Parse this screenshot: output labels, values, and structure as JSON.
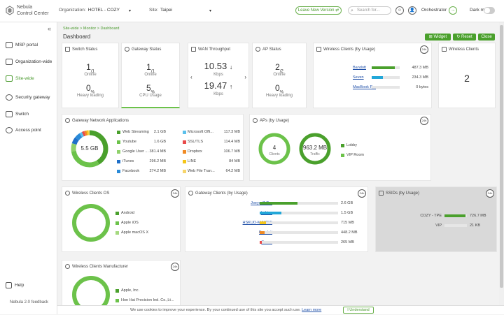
{
  "brand": {
    "line1": "Nebula",
    "line2": "Control Center"
  },
  "header": {
    "org_label": "Organization:",
    "org_value": "HOTEL - COZY",
    "site_label": "Site:",
    "site_value": "Taipei",
    "leave_btn": "Leave New Version",
    "search_placeholder": "Search for...",
    "orchestrator": "Orchestrator",
    "dark_mode": "Dark mode"
  },
  "sidebar": {
    "items": [
      {
        "label": "MSP portal"
      },
      {
        "label": "Organization-wide"
      },
      {
        "label": "Site-wide"
      },
      {
        "label": "Security gateway"
      },
      {
        "label": "Switch"
      },
      {
        "label": "Access point"
      }
    ],
    "help": "Help",
    "feedback": "Nebula 2.0 feedback"
  },
  "breadcrumb": "Site-wide > Monitor > Dashboard",
  "page_title": "Dashboard",
  "actions": {
    "widget": "Widget",
    "reset": "Reset",
    "close": "Close"
  },
  "switch_status": {
    "title": "Switch Status",
    "online": "1",
    "online_total": "/1",
    "online_label": "Online",
    "heavy": "0",
    "heavy_unit": "%",
    "heavy_label": "Heavy loading"
  },
  "gateway_status": {
    "title": "Gateway Status",
    "online": "1",
    "online_total": "/1",
    "online_label": "Online",
    "cpu": "5",
    "cpu_unit": "%",
    "cpu_label": "CPU Usage"
  },
  "wan": {
    "title": "WAN Throughput",
    "down": "10.53",
    "down_unit": "Kbps",
    "up": "19.47",
    "up_unit": "Kbps"
  },
  "ap_status": {
    "title": "AP Status",
    "online": "2",
    "online_total": "/2",
    "online_label": "Online",
    "heavy": "0",
    "heavy_unit": "%",
    "heavy_label": "Heavy loading"
  },
  "wireless_usage": {
    "title": "Wireless Clients (by Usage)",
    "badge": "24h",
    "rows": [
      {
        "name": "Bandott",
        "value": "487.3 MB",
        "pct": 0.82,
        "color": "#4aa02c"
      },
      {
        "name": "Seven",
        "value": "234.3 MB",
        "pct": 0.4,
        "color": "#22a7d8"
      },
      {
        "name": "MacBook Pro",
        "value": "0 bytes",
        "pct": 0,
        "color": "#4aa02c"
      }
    ]
  },
  "wireless_clients": {
    "title": "Wireless Clients",
    "value": "2"
  },
  "gw_apps": {
    "title": "Gateway Network Applications",
    "badge": "24h",
    "center": "5.5 GB",
    "left": [
      {
        "name": "Web Streaming",
        "value": "2.1 GB",
        "color": "#4aa02c"
      },
      {
        "name": "Youtube",
        "value": "1.6 GB",
        "color": "#6cc24a"
      },
      {
        "name": "Google User ...",
        "value": "381.4 MB",
        "color": "#8fd16a"
      },
      {
        "name": "iTunes",
        "value": "296.2 MB",
        "color": "#1e6fc8"
      },
      {
        "name": "Facebook",
        "value": "274.2 MB",
        "color": "#2a8ad8"
      }
    ],
    "right": [
      {
        "name": "Microsoft Offi...",
        "value": "117.3 MB",
        "color": "#5bc0eb"
      },
      {
        "name": "SSL/TLS",
        "value": "114.4 MB",
        "color": "#e84a4a"
      },
      {
        "name": "Dropbox",
        "value": "106.7 MB",
        "color": "#f08a24"
      },
      {
        "name": "LINE",
        "value": "84 MB",
        "color": "#f5c518"
      },
      {
        "name": "Web File Tran...",
        "value": "64.2 MB",
        "color": "#f7d56b"
      }
    ]
  },
  "aps_usage": {
    "title": "APs (by Usage)",
    "badge": "24h",
    "clients_value": "4",
    "clients_label": "Clients",
    "traffic_value": "963.2 MB",
    "traffic_label": "Traffic",
    "legend": [
      {
        "name": "Lobby",
        "color": "#4aa02c"
      },
      {
        "name": "VIP Room",
        "color": "#6cc24a"
      }
    ]
  },
  "wc_os": {
    "title": "Wireless Clients OS",
    "badge": "24h",
    "legend": [
      {
        "name": "Android",
        "color": "#4aa02c"
      },
      {
        "name": "Apple iOS",
        "color": "#6cc24a"
      },
      {
        "name": "Apple macOS X",
        "color": "#a5d97f"
      }
    ]
  },
  "gw_clients": {
    "title": "Gateway Clients (by Usage)",
    "badge": "24h",
    "rows": [
      {
        "name": "Joeys-i7-Pro",
        "value": "2.6 GB",
        "pct": 0.48,
        "color": "#4aa02c"
      },
      {
        "name": "kebing",
        "value": "1.5 GB",
        "pct": 0.28,
        "color": "#22a7d8"
      },
      {
        "name": "HSKUO-M-NZDF",
        "value": "715 MB",
        "pct": 0.08,
        "color": "#f5c518"
      },
      {
        "name": "Bandott",
        "value": "448.2 MB",
        "pct": 0.06,
        "color": "#f08a24"
      },
      {
        "name": "Seven",
        "value": "265 MB",
        "pct": 0.03,
        "color": "#e84a4a"
      }
    ]
  },
  "ssids": {
    "title": "SSIDs (by Usage)",
    "badge": "24h",
    "rows": [
      {
        "name": "COZY - TPE",
        "value": "726.7 MB",
        "pct": 0.95,
        "color": "#4aa02c"
      },
      {
        "name": "VIP",
        "value": "21 KB",
        "pct": 0,
        "color": "#4aa02c"
      }
    ]
  },
  "wc_manu": {
    "title": "Wireless Clients Manufacturer",
    "badge": "24h",
    "legend": [
      {
        "name": "Apple, Inc.",
        "color": "#4aa02c"
      },
      {
        "name": "Hon Hai Precision Ind. Co.,Lt...",
        "color": "#6cc24a"
      }
    ]
  },
  "cookie": {
    "text": "We use cookies to improve your experience. By your continued use of this site you accept such use.",
    "link": "Learn more",
    "button": "I Understand"
  }
}
